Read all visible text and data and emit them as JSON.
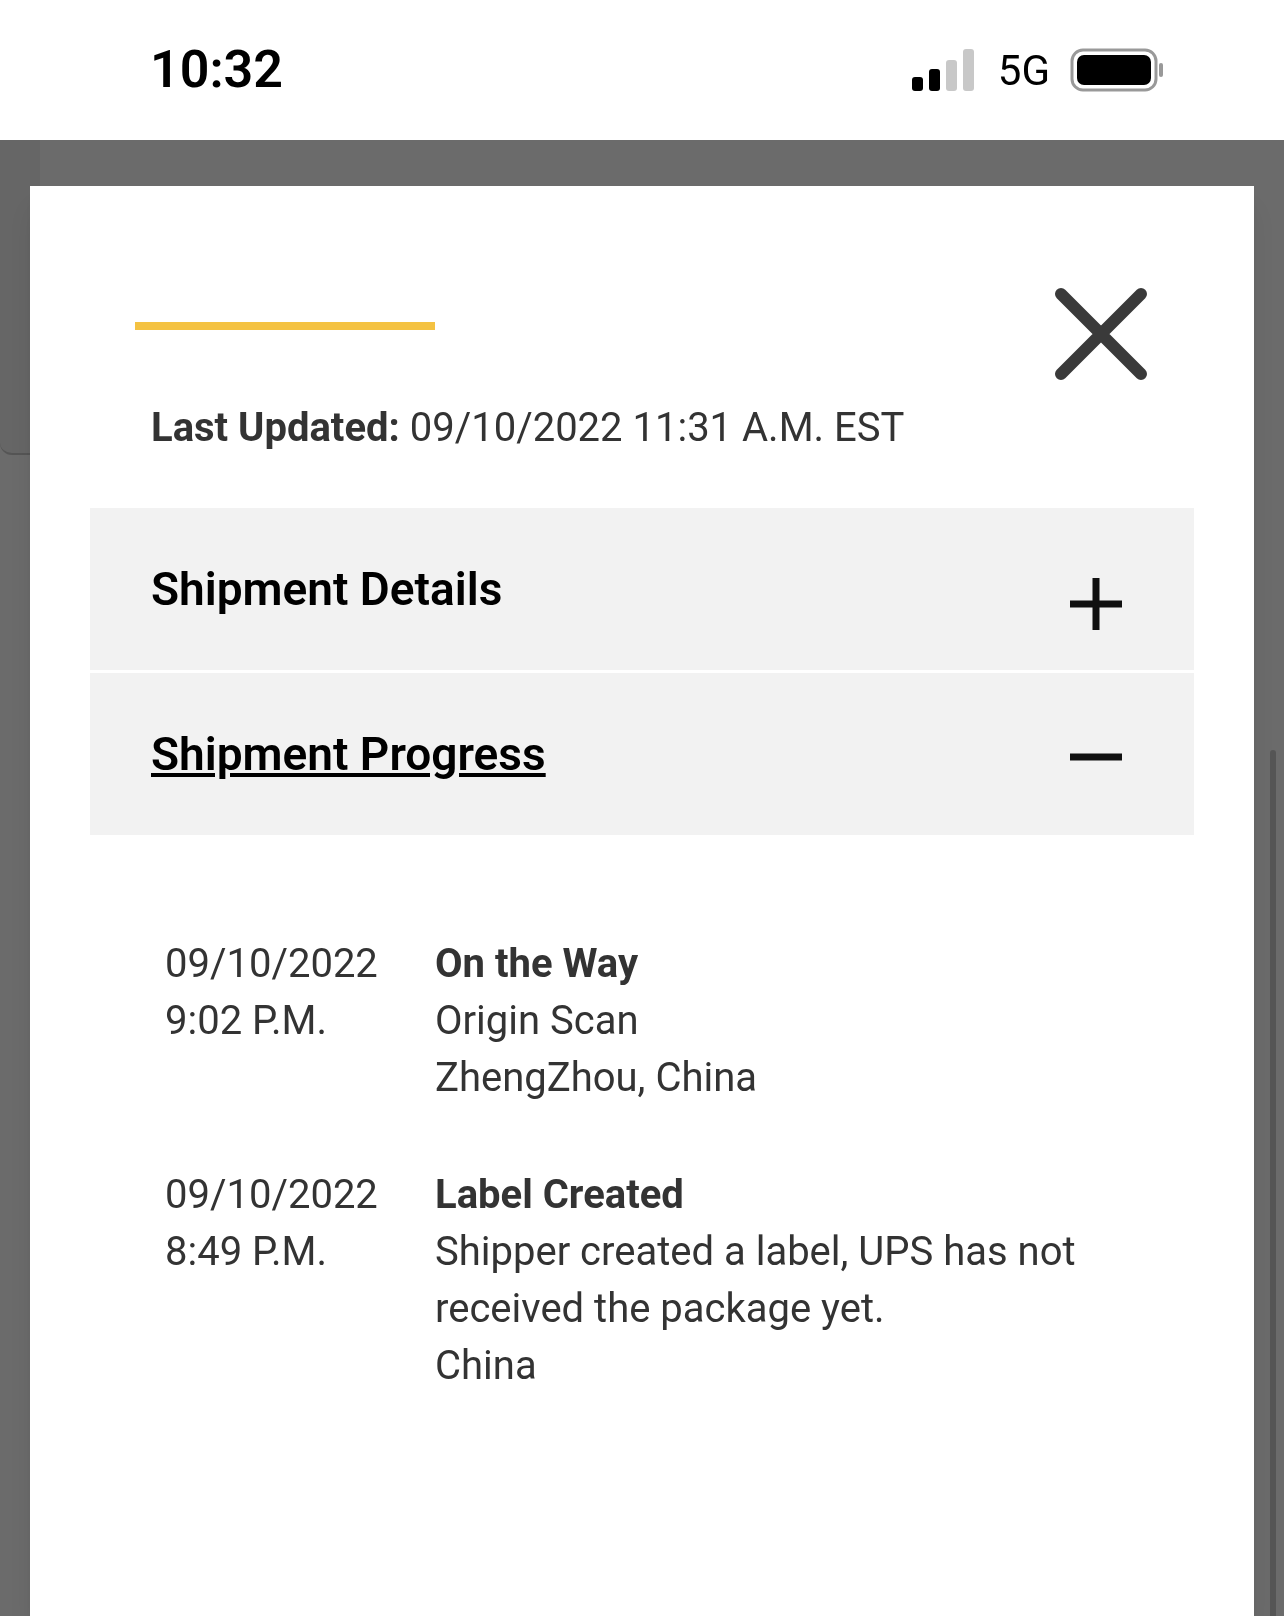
{
  "status_bar": {
    "time": "10:32",
    "network": "5G"
  },
  "modal": {
    "last_updated": {
      "label": "Last Updated:",
      "value": "09/10/2022 11:31 A.M. EST"
    },
    "sections": [
      {
        "title": "Shipment Details",
        "expanded": false
      },
      {
        "title": "Shipment Progress",
        "expanded": true
      }
    ],
    "events": [
      {
        "date": "09/10/2022",
        "time": "9:02 P.M.",
        "status": "On the Way",
        "lines": [
          "Origin Scan",
          "ZhengZhou, China"
        ]
      },
      {
        "date": "09/10/2022",
        "time": "8:49 P.M.",
        "status": "Label Created",
        "lines": [
          "Shipper created a label, UPS has not received the package yet.",
          "China"
        ]
      }
    ]
  }
}
